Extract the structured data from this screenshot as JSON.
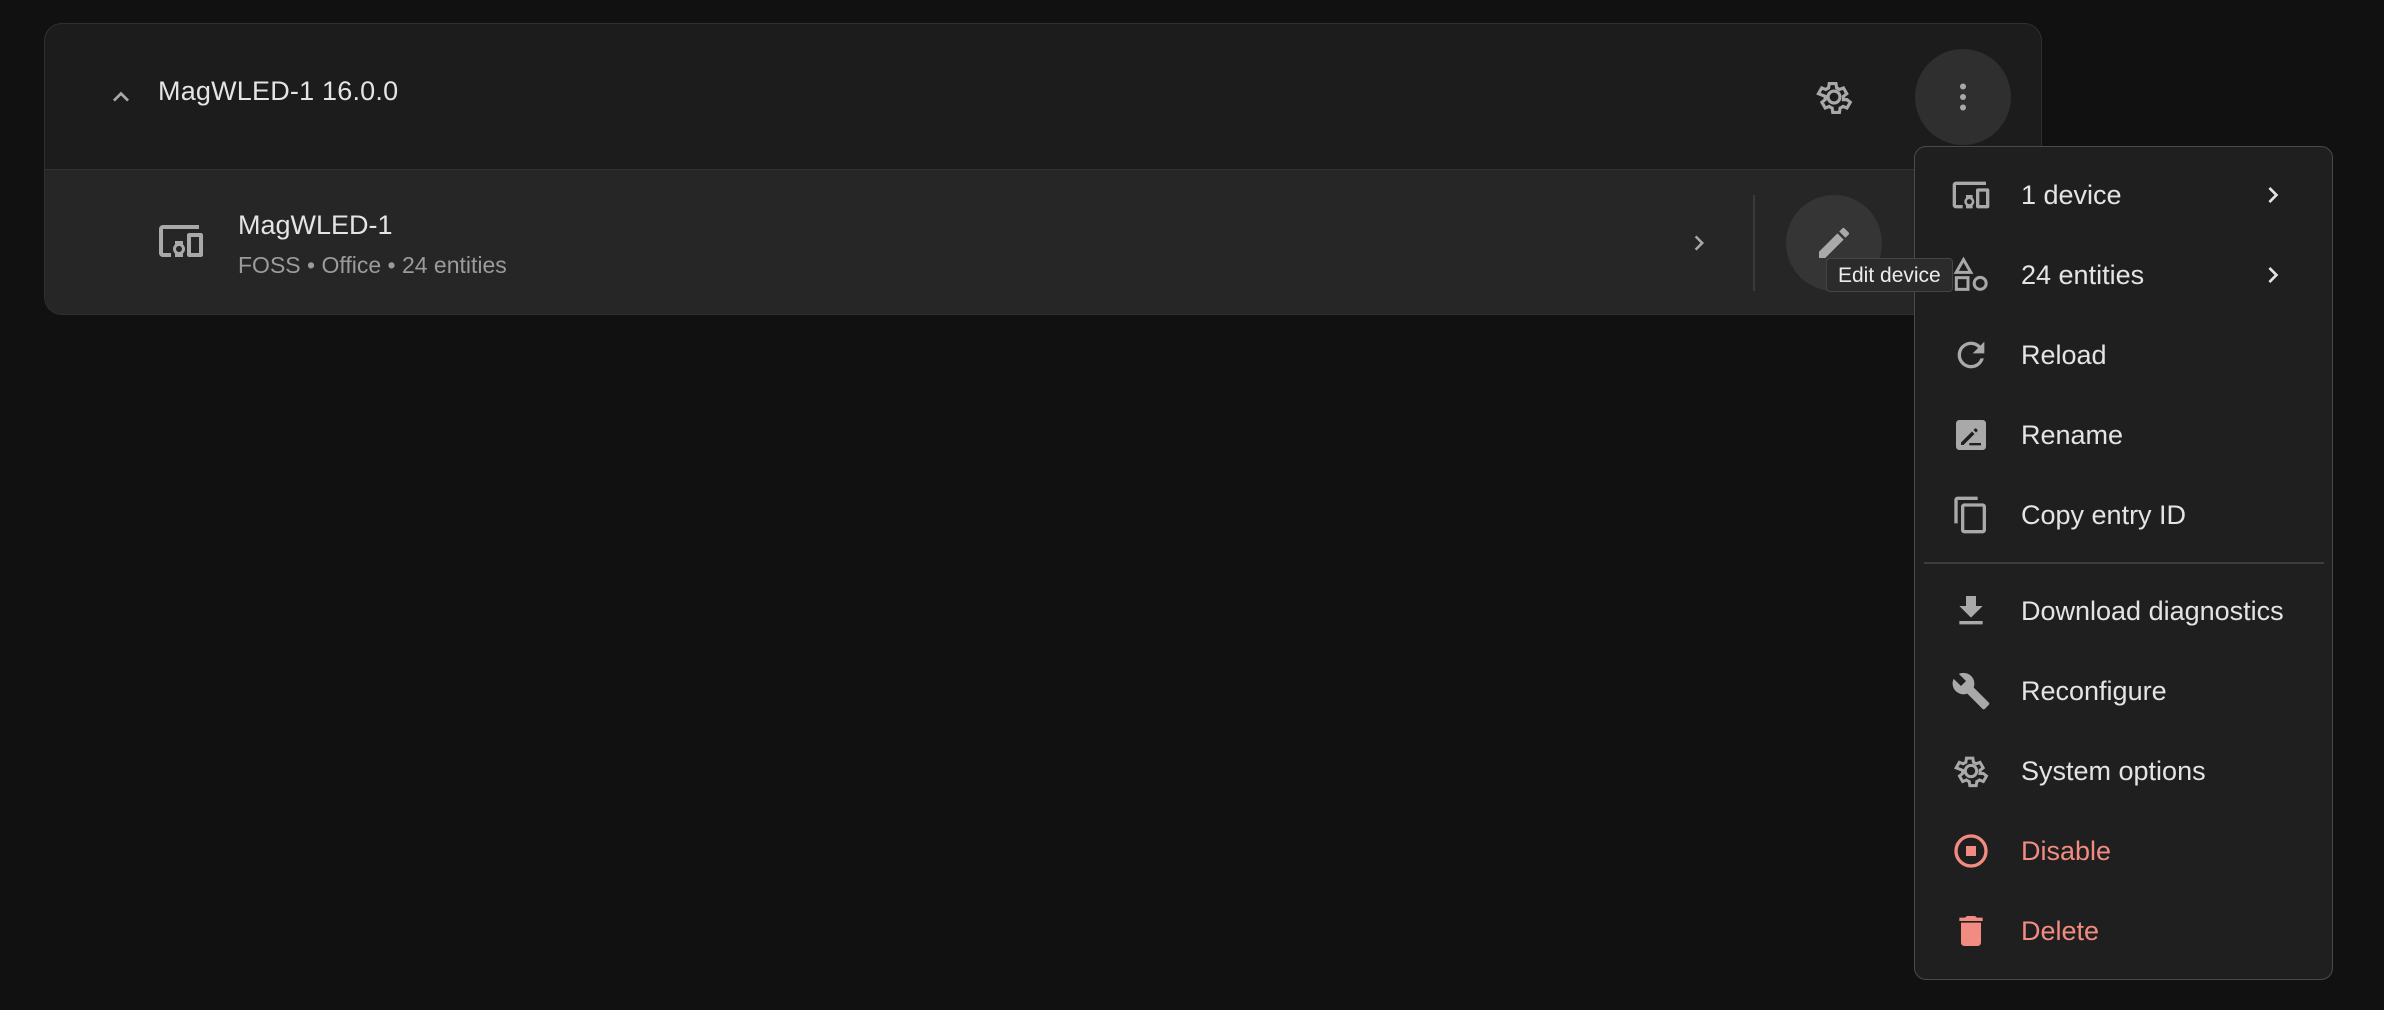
{
  "card": {
    "title": "MagWLED-1 16.0.0",
    "collapse_icon": "chevron-up-icon",
    "settings_icon": "gear-icon",
    "more_icon": "dots-vertical-icon"
  },
  "device": {
    "name": "MagWLED-1",
    "subtitle": "FOSS • Office • 24 entities",
    "icon": "devices-icon",
    "edit_icon": "pencil-icon"
  },
  "tooltip": {
    "text": "Edit device"
  },
  "menu": {
    "items": [
      {
        "label": "1 device",
        "icon": "devices-icon",
        "has_submenu": true
      },
      {
        "label": "24 entities",
        "icon": "shape-icon",
        "has_submenu": true
      },
      {
        "label": "Reload",
        "icon": "reload-icon"
      },
      {
        "label": "Rename",
        "icon": "rename-icon"
      },
      {
        "label": "Copy entry ID",
        "icon": "copy-icon"
      },
      {
        "label": "Download diagnostics",
        "icon": "download-icon"
      },
      {
        "label": "Reconfigure",
        "icon": "wrench-icon"
      },
      {
        "label": "System options",
        "icon": "gear-icon"
      },
      {
        "label": "Disable",
        "icon": "stop-circle-icon",
        "color": "#f28b82"
      },
      {
        "label": "Delete",
        "icon": "trash-icon",
        "color": "#f28b82"
      }
    ]
  },
  "colors": {
    "background": "#111111",
    "card": "#1c1c1c",
    "device_row": "#262626",
    "menu": "#1f1f1f",
    "text": "#e4e4e4",
    "secondary_text": "#9b9b9b",
    "icon": "#a9a9a9",
    "danger": "#f28b82"
  }
}
